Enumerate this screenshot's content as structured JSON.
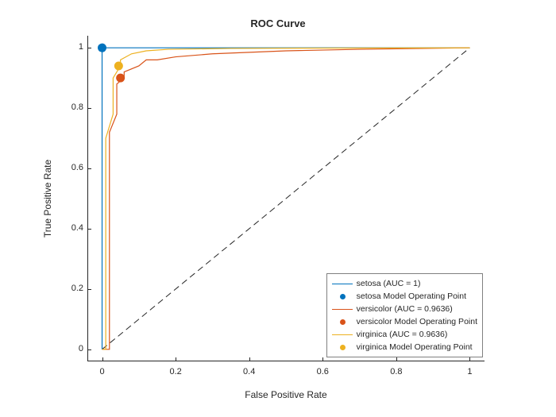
{
  "chart_data": {
    "type": "line",
    "title": "ROC Curve",
    "xlabel": "False Positive Rate",
    "ylabel": "True Positive Rate",
    "xlim": [
      -0.04,
      1.04
    ],
    "ylim": [
      -0.04,
      1.04
    ],
    "xticks": [
      0,
      0.2,
      0.4,
      0.6,
      0.8,
      1
    ],
    "yticks": [
      0,
      0.2,
      0.4,
      0.6,
      0.8,
      1
    ],
    "series": [
      {
        "name": "setosa (AUC = 1)",
        "color": "#0072BD",
        "x": [
          0,
          0,
          1
        ],
        "y": [
          0,
          1,
          1
        ]
      },
      {
        "name": "setosa Model Operating Point",
        "color": "#0072BD",
        "marker": true,
        "x": [
          0
        ],
        "y": [
          1
        ]
      },
      {
        "name": "versicolor (AUC = 0.9636)",
        "color": "#D95319",
        "x": [
          0,
          0.02,
          0.02,
          0.04,
          0.04,
          0.06,
          0.06,
          0.1,
          0.12,
          0.15,
          0.2,
          0.3,
          0.5,
          0.7,
          1
        ],
        "y": [
          0,
          0,
          0.72,
          0.78,
          0.88,
          0.9,
          0.92,
          0.94,
          0.96,
          0.96,
          0.97,
          0.98,
          0.99,
          0.995,
          1
        ]
      },
      {
        "name": "versicolor Model Operating Point",
        "color": "#D95319",
        "marker": true,
        "x": [
          0.05
        ],
        "y": [
          0.9
        ]
      },
      {
        "name": "virginica (AUC = 0.9636)",
        "color": "#EDB120",
        "x": [
          0,
          0.01,
          0.01,
          0.03,
          0.03,
          0.05,
          0.05,
          0.08,
          0.12,
          0.18,
          0.35,
          0.6,
          1
        ],
        "y": [
          0,
          0,
          0.7,
          0.78,
          0.9,
          0.94,
          0.96,
          0.98,
          0.99,
          0.995,
          0.998,
          0.999,
          1
        ]
      },
      {
        "name": "virginica Model Operating Point",
        "color": "#EDB120",
        "marker": true,
        "x": [
          0.045
        ],
        "y": [
          0.94
        ]
      }
    ],
    "diagonal": {
      "x": [
        0,
        1
      ],
      "y": [
        0,
        1
      ]
    }
  }
}
